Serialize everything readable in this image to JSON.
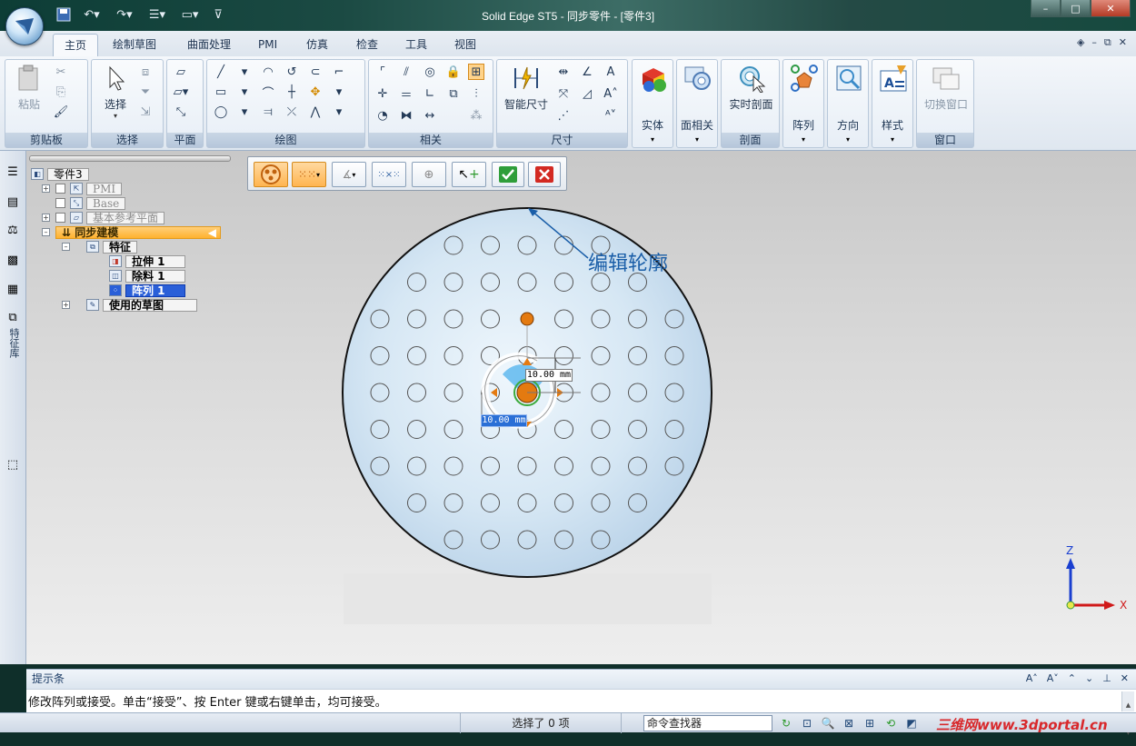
{
  "window": {
    "title": "Solid Edge ST5 - 同步零件 - [零件3]",
    "controls": [
      "–",
      "□",
      "✕"
    ],
    "qat_icons": [
      "save-icon",
      "undo-icon",
      "redo-icon",
      "align-icon",
      "window-icon"
    ]
  },
  "tabs": [
    {
      "label": "主页",
      "active": true
    },
    {
      "label": "绘制草图"
    },
    {
      "label": "曲面处理"
    },
    {
      "label": "PMI"
    },
    {
      "label": "仿真"
    },
    {
      "label": "检查"
    },
    {
      "label": "工具"
    },
    {
      "label": "视图"
    }
  ],
  "ribbon": {
    "clipboard": {
      "paste": "粘贴",
      "label": "剪贴板"
    },
    "select": {
      "select": "选择",
      "label": "选择"
    },
    "plane": {
      "label": "平面"
    },
    "draw": {
      "label": "绘图"
    },
    "relate": {
      "label": "相关"
    },
    "dimension": {
      "smart": "智能尺寸",
      "label": "尺寸"
    },
    "solid": {
      "label": "实体"
    },
    "face_related": {
      "label": "面相关"
    },
    "section": {
      "btn": "实时剖面",
      "label": "剖面"
    },
    "pattern": {
      "label": "阵列"
    },
    "orient": {
      "label": "方向"
    },
    "style": {
      "label": "样式"
    },
    "window": {
      "btn": "切换窗口",
      "label": "窗口"
    }
  },
  "tree": {
    "root": "零件3",
    "pmi": "PMI",
    "base": "Base",
    "base_planes": "基本参考平面",
    "sync": "同步建模",
    "features": "特征",
    "extrude": "拉伸 1",
    "cutout": "除料 1",
    "pattern": "阵列 1",
    "used_sketches": "使用的草图"
  },
  "left_strip": {
    "feature_library": "特征库"
  },
  "viewport": {
    "callout": "编辑轮廓",
    "dim_vertical": "10.00 mm",
    "dim_horizontal": "10.00 mm",
    "triad_z": "Z",
    "triad_x": "X"
  },
  "prompt": {
    "title": "提示条",
    "text": "修改阵列或接受。单击“接受”、按 Enter 键或右键单击，均可接受。"
  },
  "status": {
    "selection": "选择了 0 项",
    "command_finder": "命令查找器",
    "watermark": "三维网www.3dportal.cn"
  },
  "colors": {
    "accent_orange": "#ffb12e",
    "selection_blue": "#2a5fd8",
    "part_face": "#dcebf7",
    "callout_blue": "#1a5ea8"
  }
}
